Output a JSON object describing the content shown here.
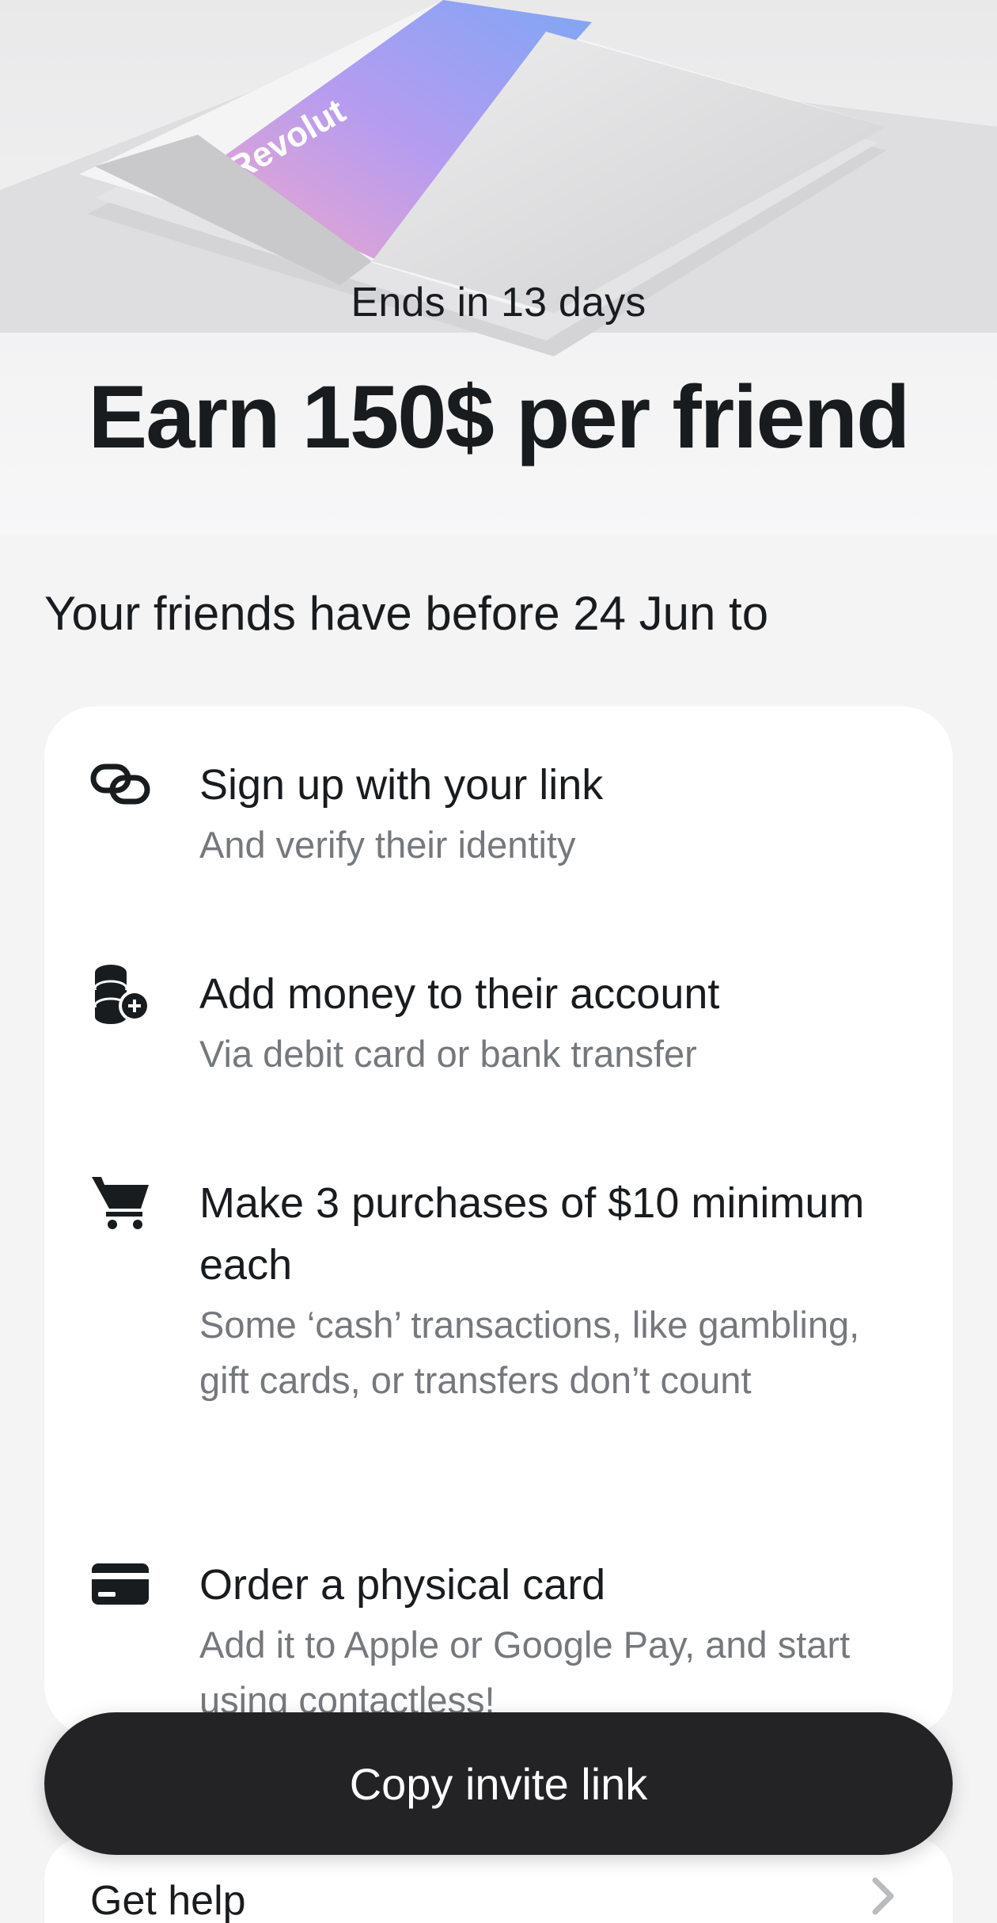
{
  "hero": {
    "card_brand": "Revolut",
    "subtitle": "Ends in 13 days",
    "title": "Earn 150$ per friend"
  },
  "section_heading": "Your friends have before 24 Jun to",
  "steps": [
    {
      "icon": "link-icon",
      "title": "Sign up with your link",
      "description": "And verify their identity"
    },
    {
      "icon": "coins-add-icon",
      "title": "Add money to their account",
      "description": "Via debit card or bank transfer"
    },
    {
      "icon": "cart-icon",
      "title": "Make 3 purchases of $10 minimum each",
      "description": "Some ‘cash’ transactions, like gambling, gift cards, or transfers don’t count"
    },
    {
      "icon": "card-icon",
      "title": "Order a physical card",
      "description": "Add it to Apple or Google Pay, and start using contactless!"
    }
  ],
  "copy_button_label": "Copy invite link",
  "help_label": "Get help",
  "colors": {
    "background": "#f4f4f5",
    "card": "#ffffff",
    "primary_text": "#191c1f",
    "secondary_text": "#75787c",
    "button": "#232325"
  }
}
